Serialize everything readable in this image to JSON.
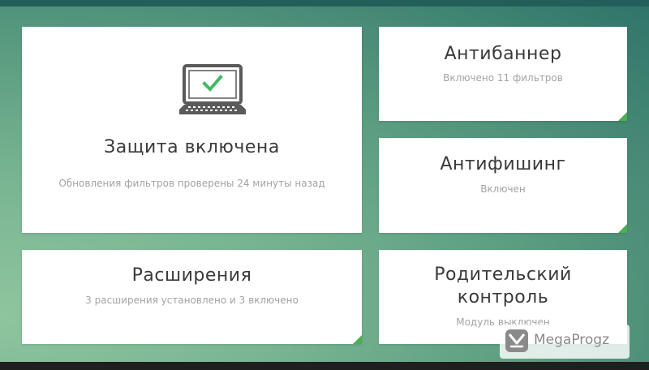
{
  "colors": {
    "accent": "#4caf50",
    "check": "#43b864",
    "title": "#3a3a3a",
    "subtitle": "#a3a3a3"
  },
  "protection": {
    "icon": "laptop-check-icon",
    "title": "Защита включена",
    "subtitle": "Обновления фильтров проверены 24 минуты назад"
  },
  "antibanner": {
    "title": "Антибаннер",
    "subtitle": "Включено 11 фильтров"
  },
  "antiphishing": {
    "title": "Антифишинг",
    "subtitle": "Включен"
  },
  "extensions": {
    "title": "Расширения",
    "subtitle": "3 расширения установлено и 3 включено"
  },
  "parental": {
    "title_line1": "Родительский",
    "title_line2": "контроль",
    "subtitle": "Модуль выключен"
  },
  "watermark": {
    "icon": "megaprogz-logo-icon",
    "text": "MegaProgz"
  }
}
